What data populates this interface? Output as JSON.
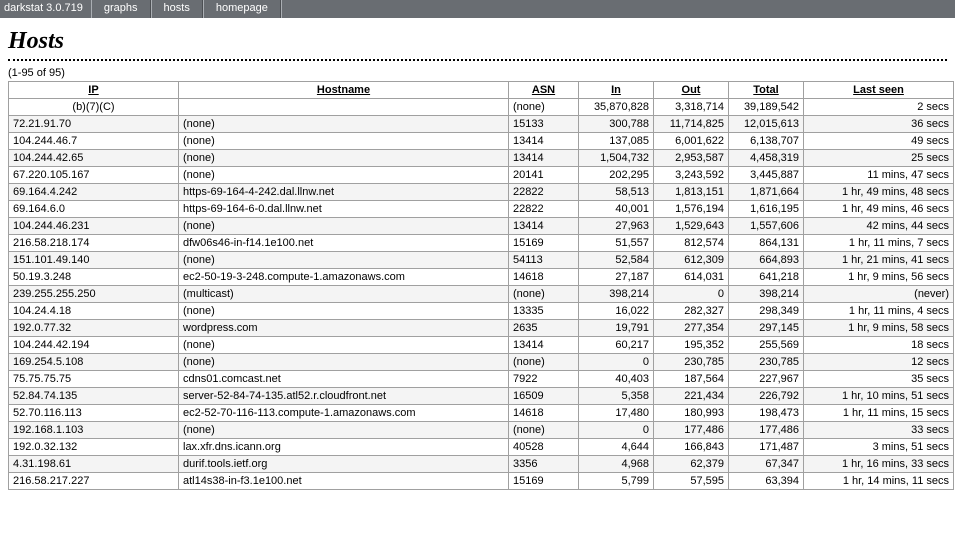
{
  "app_title": "darkstat 3.0.719",
  "nav": {
    "items": [
      "graphs",
      "hosts",
      "homepage"
    ]
  },
  "page": {
    "heading": "Hosts",
    "range": "(1-95 of 95)"
  },
  "columns": {
    "ip": "IP",
    "hostname": "Hostname",
    "asn": "ASN",
    "in": "In",
    "out": "Out",
    "total": "Total",
    "last_seen": "Last seen"
  },
  "hosts": [
    {
      "ip": "(b)(7)(C)",
      "ip_special": true,
      "hostname": "",
      "asn": "(none)",
      "in": "35,870,828",
      "out": "3,318,714",
      "total": "39,189,542",
      "last_seen": "2 secs"
    },
    {
      "ip": "72.21.91.70",
      "hostname": "(none)",
      "asn": "15133",
      "in": "300,788",
      "out": "11,714,825",
      "total": "12,015,613",
      "last_seen": "36 secs"
    },
    {
      "ip": "104.244.46.7",
      "hostname": "(none)",
      "asn": "13414",
      "in": "137,085",
      "out": "6,001,622",
      "total": "6,138,707",
      "last_seen": "49 secs"
    },
    {
      "ip": "104.244.42.65",
      "hostname": "(none)",
      "asn": "13414",
      "in": "1,504,732",
      "out": "2,953,587",
      "total": "4,458,319",
      "last_seen": "25 secs"
    },
    {
      "ip": "67.220.105.167",
      "hostname": "(none)",
      "asn": "20141",
      "in": "202,295",
      "out": "3,243,592",
      "total": "3,445,887",
      "last_seen": "11 mins, 47 secs"
    },
    {
      "ip": "69.164.4.242",
      "hostname": "https-69-164-4-242.dal.llnw.net",
      "asn": "22822",
      "in": "58,513",
      "out": "1,813,151",
      "total": "1,871,664",
      "last_seen": "1 hr, 49 mins, 48 secs"
    },
    {
      "ip": "69.164.6.0",
      "hostname": "https-69-164-6-0.dal.llnw.net",
      "asn": "22822",
      "in": "40,001",
      "out": "1,576,194",
      "total": "1,616,195",
      "last_seen": "1 hr, 49 mins, 46 secs"
    },
    {
      "ip": "104.244.46.231",
      "hostname": "(none)",
      "asn": "13414",
      "in": "27,963",
      "out": "1,529,643",
      "total": "1,557,606",
      "last_seen": "42 mins, 44 secs"
    },
    {
      "ip": "216.58.218.174",
      "hostname": "dfw06s46-in-f14.1e100.net",
      "asn": "15169",
      "in": "51,557",
      "out": "812,574",
      "total": "864,131",
      "last_seen": "1 hr, 11 mins, 7 secs"
    },
    {
      "ip": "151.101.49.140",
      "hostname": "(none)",
      "asn": "54113",
      "in": "52,584",
      "out": "612,309",
      "total": "664,893",
      "last_seen": "1 hr, 21 mins, 41 secs"
    },
    {
      "ip": "50.19.3.248",
      "hostname": "ec2-50-19-3-248.compute-1.amazonaws.com",
      "asn": "14618",
      "in": "27,187",
      "out": "614,031",
      "total": "641,218",
      "last_seen": "1 hr, 9 mins, 56 secs"
    },
    {
      "ip": "239.255.255.250",
      "hostname": "(multicast)",
      "asn": "(none)",
      "in": "398,214",
      "out": "0",
      "total": "398,214",
      "last_seen": "(never)"
    },
    {
      "ip": "104.24.4.18",
      "hostname": "(none)",
      "asn": "13335",
      "in": "16,022",
      "out": "282,327",
      "total": "298,349",
      "last_seen": "1 hr, 11 mins, 4 secs"
    },
    {
      "ip": "192.0.77.32",
      "hostname": "wordpress.com",
      "asn": "2635",
      "in": "19,791",
      "out": "277,354",
      "total": "297,145",
      "last_seen": "1 hr, 9 mins, 58 secs"
    },
    {
      "ip": "104.244.42.194",
      "hostname": "(none)",
      "asn": "13414",
      "in": "60,217",
      "out": "195,352",
      "total": "255,569",
      "last_seen": "18 secs"
    },
    {
      "ip": "169.254.5.108",
      "hostname": "(none)",
      "asn": "(none)",
      "in": "0",
      "out": "230,785",
      "total": "230,785",
      "last_seen": "12 secs"
    },
    {
      "ip": "75.75.75.75",
      "hostname": "cdns01.comcast.net",
      "asn": "7922",
      "in": "40,403",
      "out": "187,564",
      "total": "227,967",
      "last_seen": "35 secs"
    },
    {
      "ip": "52.84.74.135",
      "hostname": "server-52-84-74-135.atl52.r.cloudfront.net",
      "asn": "16509",
      "in": "5,358",
      "out": "221,434",
      "total": "226,792",
      "last_seen": "1 hr, 10 mins, 51 secs"
    },
    {
      "ip": "52.70.116.113",
      "hostname": "ec2-52-70-116-113.compute-1.amazonaws.com",
      "asn": "14618",
      "in": "17,480",
      "out": "180,993",
      "total": "198,473",
      "last_seen": "1 hr, 11 mins, 15 secs"
    },
    {
      "ip": "192.168.1.103",
      "hostname": "(none)",
      "asn": "(none)",
      "in": "0",
      "out": "177,486",
      "total": "177,486",
      "last_seen": "33 secs"
    },
    {
      "ip": "192.0.32.132",
      "hostname": "lax.xfr.dns.icann.org",
      "asn": "40528",
      "in": "4,644",
      "out": "166,843",
      "total": "171,487",
      "last_seen": "3 mins, 51 secs"
    },
    {
      "ip": "4.31.198.61",
      "hostname": "durif.tools.ietf.org",
      "asn": "3356",
      "in": "4,968",
      "out": "62,379",
      "total": "67,347",
      "last_seen": "1 hr, 16 mins, 33 secs"
    },
    {
      "ip": "216.58.217.227",
      "hostname": "atl14s38-in-f3.1e100.net",
      "asn": "15169",
      "in": "5,799",
      "out": "57,595",
      "total": "63,394",
      "last_seen": "1 hr, 14 mins, 11 secs"
    }
  ]
}
